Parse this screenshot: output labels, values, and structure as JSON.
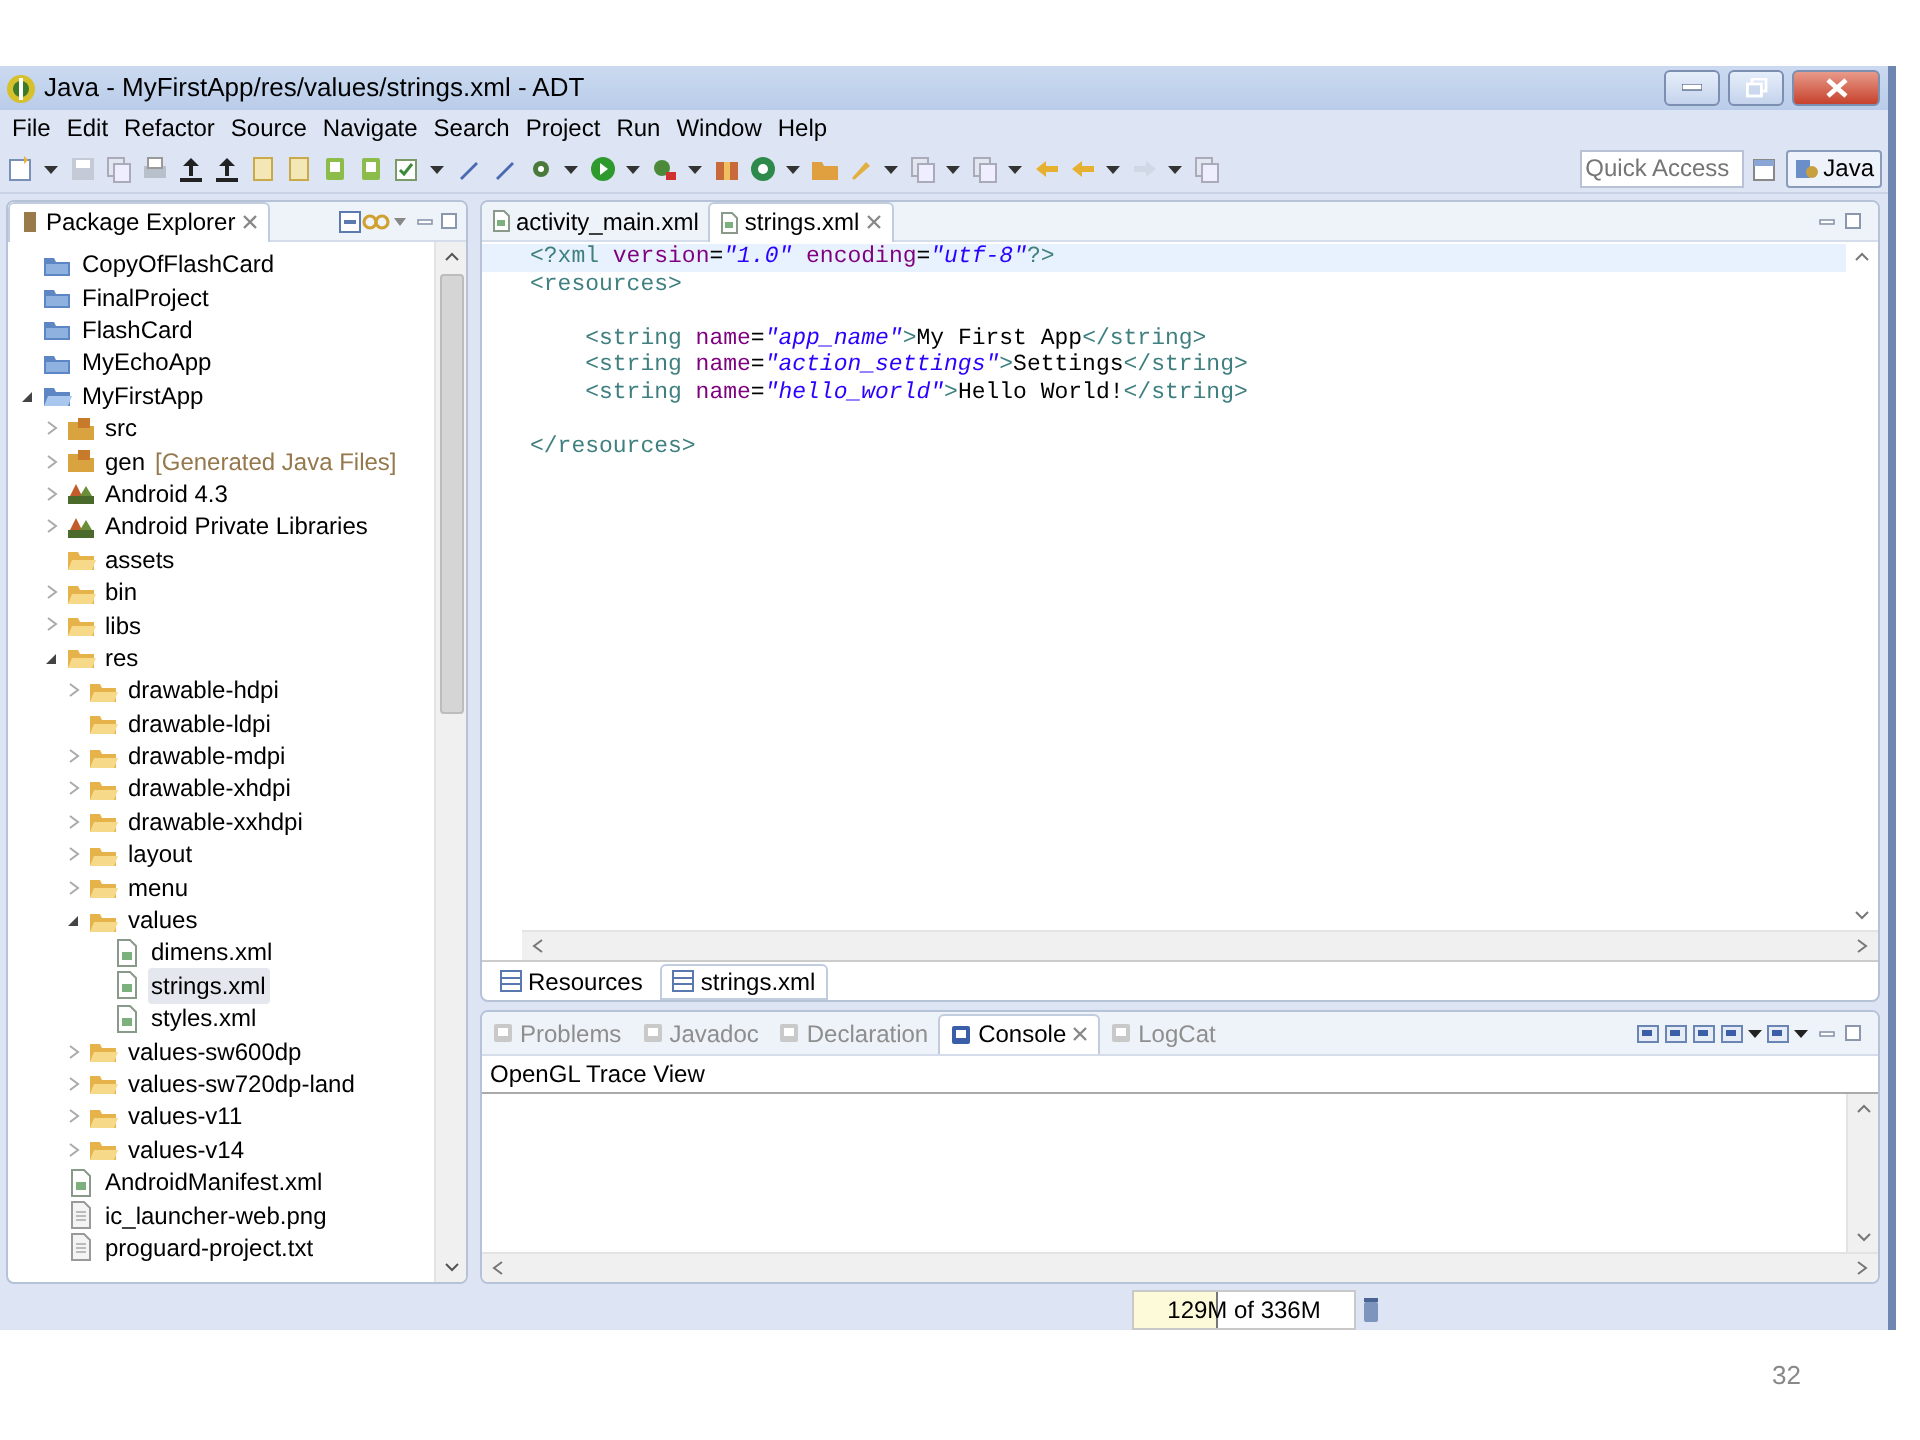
{
  "window": {
    "title": "Java - MyFirstApp/res/values/strings.xml - ADT"
  },
  "menu": [
    "File",
    "Edit",
    "Refactor",
    "Source",
    "Navigate",
    "Search",
    "Project",
    "Run",
    "Window",
    "Help"
  ],
  "toolbar": {
    "quick_access": {
      "placeholder": "Quick Access"
    },
    "perspective": {
      "label": "Java",
      "selected": true
    }
  },
  "package_explorer": {
    "title": "Package Explorer",
    "tree": [
      {
        "label": "CopyOfFlashCard",
        "kind": "project",
        "selected": false
      },
      {
        "label": "FinalProject",
        "kind": "project",
        "selected": false
      },
      {
        "label": "FlashCard",
        "kind": "project",
        "selected": false
      },
      {
        "label": "MyEchoApp",
        "kind": "project",
        "selected": false
      },
      {
        "label": "MyFirstApp",
        "kind": "open-project",
        "expanded": true,
        "selected": false,
        "children": [
          {
            "label": "src",
            "kind": "source-folder",
            "expanded": false,
            "selected": false
          },
          {
            "label": "gen",
            "decoration": "[Generated Java Files]",
            "kind": "source-folder",
            "expanded": false,
            "selected": false
          },
          {
            "label": "Android 4.3",
            "kind": "library",
            "expanded": false,
            "selected": false
          },
          {
            "label": "Android Private Libraries",
            "kind": "library",
            "expanded": false,
            "selected": false
          },
          {
            "label": "assets",
            "kind": "folder",
            "selected": false
          },
          {
            "label": "bin",
            "kind": "folder",
            "expanded": false,
            "selected": false
          },
          {
            "label": "libs",
            "kind": "folder",
            "expanded": false,
            "selected": false
          },
          {
            "label": "res",
            "kind": "folder",
            "expanded": true,
            "selected": false,
            "children": [
              {
                "label": "drawable-hdpi",
                "kind": "folder",
                "expanded": false,
                "selected": false
              },
              {
                "label": "drawable-ldpi",
                "kind": "folder",
                "selected": false
              },
              {
                "label": "drawable-mdpi",
                "kind": "folder",
                "expanded": false,
                "selected": false
              },
              {
                "label": "drawable-xhdpi",
                "kind": "folder",
                "expanded": false,
                "selected": false
              },
              {
                "label": "drawable-xxhdpi",
                "kind": "folder",
                "expanded": false,
                "selected": false
              },
              {
                "label": "layout",
                "kind": "folder",
                "expanded": false,
                "selected": false
              },
              {
                "label": "menu",
                "kind": "folder",
                "expanded": false,
                "selected": false
              },
              {
                "label": "values",
                "kind": "folder",
                "expanded": true,
                "selected": false,
                "children": [
                  {
                    "label": "dimens.xml",
                    "kind": "xml-file",
                    "selected": false
                  },
                  {
                    "label": "strings.xml",
                    "kind": "xml-file",
                    "selected": true
                  },
                  {
                    "label": "styles.xml",
                    "kind": "xml-file",
                    "selected": false
                  }
                ]
              },
              {
                "label": "values-sw600dp",
                "kind": "folder",
                "expanded": false,
                "selected": false
              },
              {
                "label": "values-sw720dp-land",
                "kind": "folder",
                "expanded": false,
                "selected": false
              },
              {
                "label": "values-v11",
                "kind": "folder",
                "expanded": false,
                "selected": false
              },
              {
                "label": "values-v14",
                "kind": "folder",
                "expanded": false,
                "selected": false
              }
            ]
          },
          {
            "label": "AndroidManifest.xml",
            "kind": "xml-file",
            "selected": false
          },
          {
            "label": "ic_launcher-web.png",
            "kind": "file",
            "selected": false
          },
          {
            "label": "proguard-project.txt",
            "kind": "file",
            "selected": false
          }
        ]
      }
    ]
  },
  "editor": {
    "tabs": [
      {
        "label": "activity_main.xml",
        "selected": false
      },
      {
        "label": "strings.xml",
        "selected": true
      }
    ],
    "lines": [
      {
        "tokens": [
          {
            "kind": "tag",
            "text": "<?xml"
          },
          {
            "kind": "attr",
            "text": "version"
          },
          {
            "kind": "eq",
            "text": "="
          },
          {
            "kind": "value",
            "text": "\"1.0\""
          },
          {
            "kind": "attr",
            "text": "encoding"
          },
          {
            "kind": "eq",
            "text": "="
          },
          {
            "kind": "value",
            "text": "\"utf-8\""
          },
          {
            "kind": "tag",
            "text": "?>"
          }
        ],
        "current": true
      },
      {
        "tokens": [
          {
            "kind": "tag",
            "text": "<resources>"
          }
        ],
        "current": false
      },
      {
        "current": false
      },
      {
        "tokens": [
          {
            "kind": "tag",
            "text": "<string"
          },
          {
            "kind": "attr",
            "text": "name"
          },
          {
            "kind": "eq",
            "text": "="
          },
          {
            "kind": "value",
            "text": "\"app_name\""
          },
          {
            "kind": "tag",
            "text": ">"
          },
          {
            "kind": "text",
            "text": "My First App"
          },
          {
            "kind": "tag",
            "text": "</string>"
          }
        ],
        "indented": true,
        "current": false
      },
      {
        "tokens": [
          {
            "kind": "tag",
            "text": "<string"
          },
          {
            "kind": "attr",
            "text": "name"
          },
          {
            "kind": "eq",
            "text": "="
          },
          {
            "kind": "value",
            "text": "\"action_settings\""
          },
          {
            "kind": "tag",
            "text": ">"
          },
          {
            "kind": "text",
            "text": "Settings"
          },
          {
            "kind": "tag",
            "text": "</string>"
          }
        ],
        "indented": true,
        "current": false
      },
      {
        "tokens": [
          {
            "kind": "tag",
            "text": "<string"
          },
          {
            "kind": "attr",
            "text": "name"
          },
          {
            "kind": "eq",
            "text": "="
          },
          {
            "kind": "value",
            "text": "\"hello_world\""
          },
          {
            "kind": "tag",
            "text": ">"
          },
          {
            "kind": "text",
            "text": "Hello World!"
          },
          {
            "kind": "tag",
            "text": "</string>"
          }
        ],
        "indented": true,
        "current": false
      },
      {
        "current": false
      },
      {
        "tokens": [
          {
            "kind": "tag",
            "text": "</resources>"
          }
        ],
        "current": false
      }
    ],
    "bottom_tabs": [
      {
        "label": "Resources",
        "selected": false
      },
      {
        "label": "strings.xml",
        "selected": true
      }
    ]
  },
  "console_panel": {
    "tabs": [
      {
        "label": "Problems",
        "selected": false
      },
      {
        "label": "Javadoc",
        "selected": false
      },
      {
        "label": "Declaration",
        "selected": false
      },
      {
        "label": "Console",
        "selected": true
      },
      {
        "label": "LogCat",
        "selected": false
      }
    ],
    "console_title": "OpenGL Trace View"
  },
  "status_bar": {
    "memory": {
      "text": "129M of 336M",
      "level": 0.38
    }
  },
  "slide_number": "32"
}
